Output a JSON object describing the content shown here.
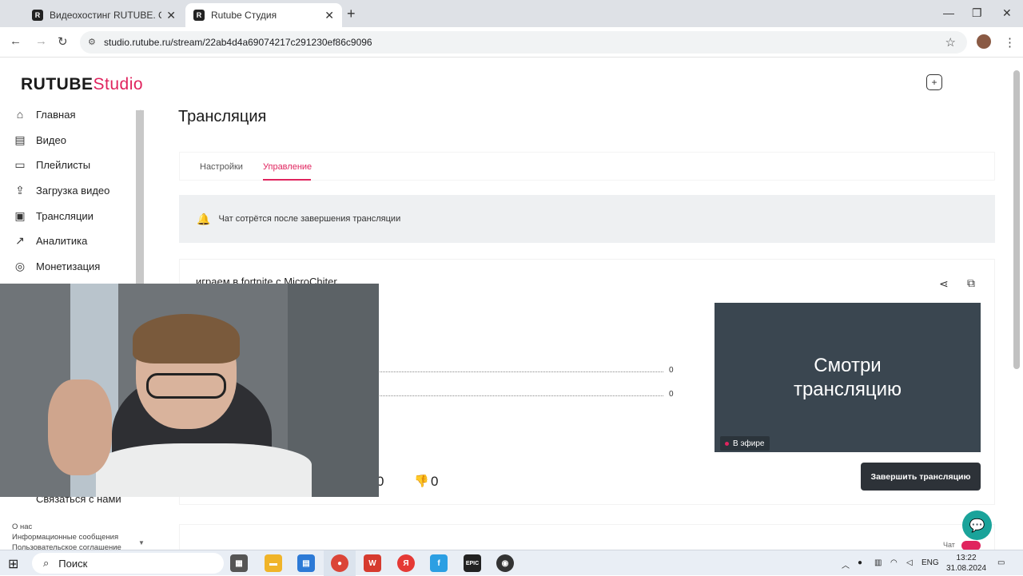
{
  "browser": {
    "tabs": [
      {
        "title": "Видеохостинг RUTUBE. Смотрите",
        "favicon": "R"
      },
      {
        "title": "Rutube Студия",
        "favicon": "R"
      }
    ],
    "url": "studio.rutube.ru/stream/22ab4d4a69074217c291230ef86c9096"
  },
  "header": {
    "logo_main": "RUTUBE",
    "logo_accent": "Studio"
  },
  "sidebar": {
    "items": [
      {
        "label": "Главная",
        "icon": "home-icon"
      },
      {
        "label": "Видео",
        "icon": "video-icon"
      },
      {
        "label": "Плейлисты",
        "icon": "playlist-icon"
      },
      {
        "label": "Загрузка видео",
        "icon": "upload-icon"
      },
      {
        "label": "Трансляции",
        "icon": "broadcast-icon"
      },
      {
        "label": "Аналитика",
        "icon": "analytics-icon"
      },
      {
        "label": "Монетизация",
        "icon": "monetization-icon"
      }
    ],
    "contact": "Связаться с нами",
    "footer_links": [
      "О нас",
      "Информационные сообщения",
      "Пользовательское соглашение"
    ]
  },
  "main": {
    "title": "Трансляция",
    "tabs": [
      "Настройки",
      "Управление"
    ],
    "active_tab": "Управление",
    "notice": "Чат сотрётся после завершения трансляции",
    "stream": {
      "title": "играем в fortnite с MicroChiter",
      "line1_value": "0",
      "line2_value": "0",
      "likes": "0",
      "dislikes": "0",
      "preview_text_line1": "Смотри",
      "preview_text_line2": "трансляцию",
      "live_badge": "В эфире",
      "end_button": "Завершить трансляцию"
    },
    "chat_label": "Чат"
  },
  "taskbar": {
    "search": "Поиск",
    "lang": "ENG",
    "time": "13:22",
    "date": "31.08.2024"
  },
  "colors": {
    "accent": "#e0245e",
    "dark_button": "#2d3238",
    "preview_bg": "#3a4650",
    "support_button": "#1aa39a"
  }
}
